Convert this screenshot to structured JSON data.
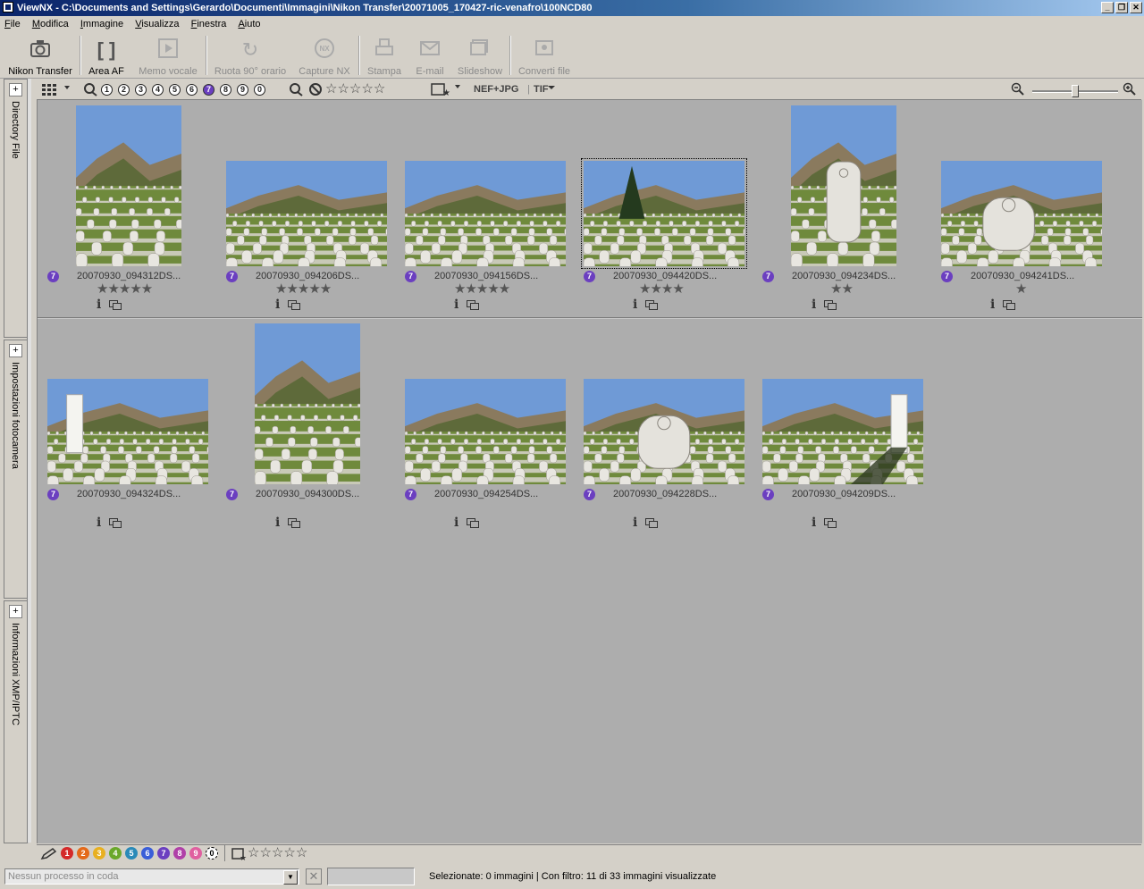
{
  "window": {
    "title": "ViewNX - C:\\Documents and Settings\\Gerardo\\Documenti\\Immagini\\Nikon Transfer\\20071005_170427-ric-venafro\\100NCD80"
  },
  "menu": [
    "File",
    "Modifica",
    "Immagine",
    "Visualizza",
    "Finestra",
    "Aiuto"
  ],
  "toolbar": [
    {
      "label": "Nikon Transfer",
      "icon": "camera-icon",
      "enabled": true
    },
    {
      "label": "Area AF",
      "icon": "af-brackets-icon",
      "enabled": true
    },
    {
      "label": "Memo vocale",
      "icon": "play-icon",
      "enabled": false
    },
    {
      "label": "Ruota 90° orario",
      "icon": "rotate-icon",
      "enabled": false
    },
    {
      "label": "Capture NX",
      "icon": "capture-nx-icon",
      "enabled": false
    },
    {
      "label": "Stampa",
      "icon": "printer-icon",
      "enabled": false
    },
    {
      "label": "E-mail",
      "icon": "envelope-icon",
      "enabled": false
    },
    {
      "label": "Slideshow",
      "icon": "slideshow-icon",
      "enabled": false
    },
    {
      "label": "Converti file",
      "icon": "convert-icon",
      "enabled": false
    }
  ],
  "sidebar": [
    "Directory File",
    "Impostazioni fotocamera",
    "Informazioni XMP/IPTC"
  ],
  "filter": {
    "labels": [
      "1",
      "2",
      "3",
      "4",
      "5",
      "6",
      "7",
      "8",
      "9",
      "0"
    ],
    "selected_label": "7",
    "file_types": [
      "NEF+JPG",
      "TIF"
    ]
  },
  "thumbnails": [
    {
      "name": "20070930_094312DS...",
      "label": "7",
      "stars": 5,
      "orientation": "portrait",
      "scene": "cemetery-rows"
    },
    {
      "name": "20070930_094206DS...",
      "label": "7",
      "stars": 5,
      "orientation": "landscape",
      "scene": "cemetery-hills"
    },
    {
      "name": "20070930_094156DS...",
      "label": "7",
      "stars": 5,
      "orientation": "landscape",
      "scene": "cemetery-wide"
    },
    {
      "name": "20070930_094420DS...",
      "label": "7",
      "stars": 4,
      "orientation": "landscape",
      "scene": "cemetery-tree",
      "selected": true
    },
    {
      "name": "20070930_094234DS...",
      "label": "7",
      "stars": 2,
      "orientation": "portrait",
      "scene": "tombstone-closeup"
    },
    {
      "name": "20070930_094241DS...",
      "label": "7",
      "stars": 1,
      "orientation": "landscape",
      "scene": "tombstone-wide"
    },
    {
      "name": "20070930_094324DS...",
      "label": "7",
      "stars": 0,
      "orientation": "landscape",
      "scene": "white-tower"
    },
    {
      "name": "20070930_094300DS...",
      "label": "7",
      "stars": 0,
      "orientation": "portrait",
      "scene": "cemetery-rows"
    },
    {
      "name": "20070930_094254DS...",
      "label": "7",
      "stars": 0,
      "orientation": "landscape",
      "scene": "cemetery-dense"
    },
    {
      "name": "20070930_094228DS...",
      "label": "7",
      "stars": 0,
      "orientation": "landscape",
      "scene": "tombstone-closeup"
    },
    {
      "name": "20070930_094209DS...",
      "label": "7",
      "stars": 0,
      "orientation": "landscape",
      "scene": "tower-shadow"
    }
  ],
  "bottom_labels": [
    {
      "n": "1",
      "color": "#d42a2a"
    },
    {
      "n": "2",
      "color": "#e46a1a"
    },
    {
      "n": "3",
      "color": "#e8b020"
    },
    {
      "n": "4",
      "color": "#6aa82a"
    },
    {
      "n": "5",
      "color": "#2a8ab8"
    },
    {
      "n": "6",
      "color": "#3a5ed8"
    },
    {
      "n": "7",
      "color": "#6b3fc0"
    },
    {
      "n": "8",
      "color": "#b040a8"
    },
    {
      "n": "9",
      "color": "#e060a0"
    },
    {
      "n": "0",
      "color": "#ffffff"
    }
  ],
  "status": {
    "queue_placeholder": "Nessun processo in coda",
    "text": "Selezionate: 0 immagini | Con filtro: 11 di 33 immagini visualizzate"
  }
}
